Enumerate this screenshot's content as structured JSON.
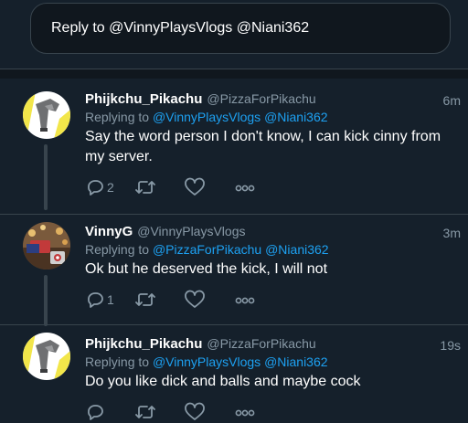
{
  "reply_box": {
    "text": "Reply to @VinnyPlaysVlogs @Niani362"
  },
  "tweets": [
    {
      "name": "Phijkchu_Pikachu",
      "handle": "@PizzaForPikachu",
      "time": "6m",
      "replying_prefix": "Replying to",
      "mention_1": "@VinnyPlaysVlogs",
      "mention_2": "@Niani362",
      "text": "Say the word person I don't know, I can kick cinny from my server.",
      "reply_count": "2",
      "avatar": "pikachu-avatar"
    },
    {
      "name": "VinnyG",
      "handle": "@VinnyPlaysVlogs",
      "time": "3m",
      "replying_prefix": "Replying to",
      "mention_1": "@PizzaForPikachu",
      "mention_2": "@Niani362",
      "text": "Ok but he deserved the kick, I will not",
      "reply_count": "1",
      "avatar": "vinny-avatar"
    },
    {
      "name": "Phijkchu_Pikachu",
      "handle": "@PizzaForPikachu",
      "time": "19s",
      "replying_prefix": "Replying to",
      "mention_1": "@VinnyPlaysVlogs",
      "mention_2": "@Niani362",
      "text": "Do you like dick and balls and maybe cock",
      "reply_count": "",
      "avatar": "pikachu-avatar"
    }
  ],
  "icons": {
    "reply": "reply-icon",
    "retweet": "retweet-icon",
    "like": "heart-icon",
    "more": "more-icon"
  },
  "colors": {
    "background": "#15202b",
    "muted": "#8899a6",
    "link": "#1da1f2",
    "border": "#38444d"
  }
}
